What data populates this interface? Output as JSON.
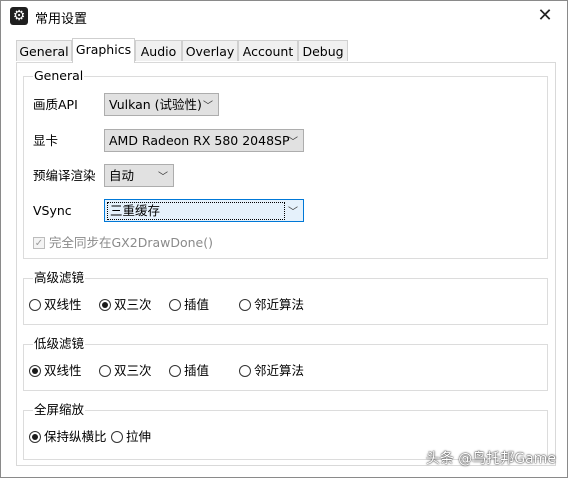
{
  "window": {
    "title": "常用设置",
    "app_icon": "gear-icon",
    "close_symbol": "✕"
  },
  "tabs": [
    "General",
    "Graphics",
    "Audio",
    "Overlay",
    "Account",
    "Debug"
  ],
  "active_tab": "Graphics",
  "general": {
    "title": "General",
    "api_label": "画质API",
    "api_value": "Vulkan (试验性)",
    "adapter_label": "显卡",
    "adapter_value": "AMD Radeon RX 580 2048SP",
    "shader_label": "预编译渲染",
    "shader_value": "自动",
    "vsync_label": "VSync",
    "vsync_value": "三重缓存",
    "sync_checkbox_label": "完全同步在GX2DrawDone()",
    "sync_checked": true
  },
  "upscale": {
    "title": "高级滤镜",
    "options": [
      "双线性",
      "双三次",
      "插值",
      "邻近算法"
    ],
    "selected": 1
  },
  "downscale": {
    "title": "低级滤镜",
    "options": [
      "双线性",
      "双三次",
      "插值",
      "邻近算法"
    ],
    "selected": 0
  },
  "fullscreen": {
    "title": "全屏缩放",
    "options": [
      "保持纵横比",
      "拉伸"
    ],
    "selected": 0
  },
  "watermark": "头条 @鸟托邦Game"
}
